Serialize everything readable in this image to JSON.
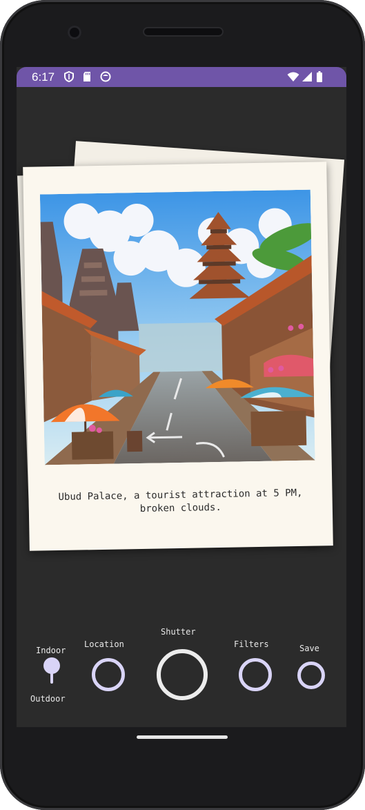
{
  "status_bar": {
    "time": "6:17",
    "left_icons": [
      "shield-icon",
      "sd-card-icon",
      "app-icon"
    ],
    "right_icons": [
      "wifi-icon",
      "cell-signal-icon",
      "battery-icon"
    ],
    "background_color": "#6f55a8"
  },
  "polaroid": {
    "caption": "Ubud Palace, a tourist attraction at 5 PM, broken clouds.",
    "image_description_icon": "street-scene-illustration"
  },
  "controls": {
    "indoor_label": "Indoor",
    "outdoor_label": "Outdoor",
    "location_label": "Location",
    "shutter_label": "Shutter",
    "filters_label": "Filters",
    "save_label": "Save",
    "accent_color": "#d9d4f7",
    "shutter_color": "#ececec"
  }
}
